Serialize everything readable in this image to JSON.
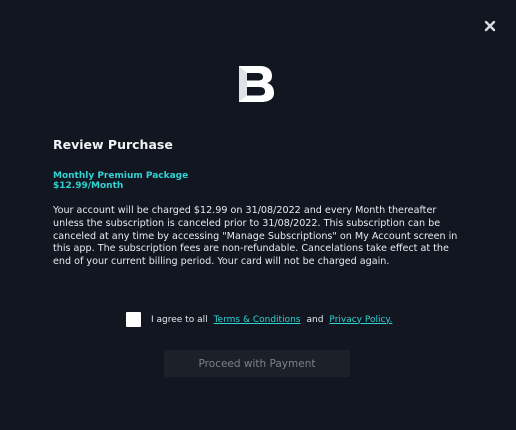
{
  "modal": {
    "title": "Review Purchase",
    "close_icon": "close-icon",
    "logo_icon": "brand-b-logo",
    "accent_color": "#32d2d3"
  },
  "package": {
    "name": "Monthly Premium Package",
    "price": "$12.99/Month"
  },
  "disclaimer": "Your account will be charged $12.99 on 31/08/2022 and every Month thereafter unless the subscription is canceled prior to 31/08/2022. This subscription can be canceled at any time by accessing \"Manage Subscriptions\" on My Account screen in this app. The subscription fees are non-refundable. Cancelations take effect at the end of your current billing period. Your card will not be charged again.",
  "agreement": {
    "checked": false,
    "prefix": "I agree to all",
    "terms_link": "Terms & Conditions",
    "and_text": "and",
    "privacy_link": "Privacy Policy."
  },
  "actions": {
    "proceed_label": "Proceed with Payment"
  }
}
